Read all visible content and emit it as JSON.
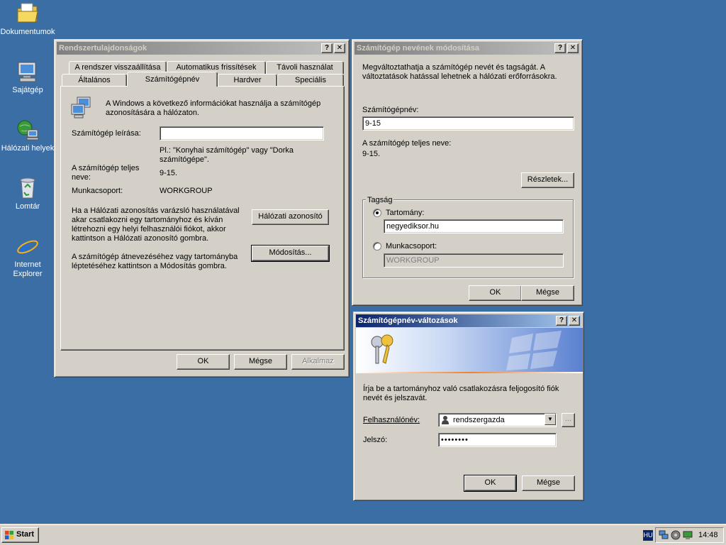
{
  "desktop": {
    "icons": [
      {
        "label": "Dokumentumok",
        "icon": "folder-documents-icon"
      },
      {
        "label": "Sajátgép",
        "icon": "my-computer-icon"
      },
      {
        "label": "Hálózati helyek",
        "icon": "network-places-icon"
      },
      {
        "label": "Lomtár",
        "icon": "recycle-bin-icon"
      },
      {
        "label": "Internet Explorer",
        "icon": "internet-explorer-icon"
      }
    ]
  },
  "system_properties": {
    "title": "Rendszertulajdonságok",
    "tabs_row1": [
      "A rendszer visszaállítása",
      "Automatikus frissítések",
      "Távoli használat"
    ],
    "tabs_row2": [
      "Általános",
      "Számítógépnév",
      "Hardver",
      "Speciális"
    ],
    "selected_tab": "Számítógépnév",
    "intro": "A Windows a következő információkat használja a számítógép azonosítására a hálózaton.",
    "description_label": "Számítógép leírása:",
    "description_value": "",
    "example": "Pl.: \"Konyhai számítógép\" vagy \"Dorka számítógépe\".",
    "full_name_label": "A számítógép teljes neve:",
    "full_name_value": "9-15.",
    "workgroup_label": "Munkacsoport:",
    "workgroup_value": "WORKGROUP",
    "network_id_text": "Ha a Hálózati azonosítás varázsló használatával akar csatlakozni egy tartományhoz és kíván létrehozni egy helyi felhasználói fiókot, akkor kattintson a Hálózati azonosító gombra.",
    "network_id_button": "Hálózati azonosító",
    "rename_text": "A számítógép átnevezéséhez vagy tartományba léptetéséhez kattintson a Módosítás gombra.",
    "change_button": "Módosítás...",
    "ok": "OK",
    "cancel": "Mégse",
    "apply": "Alkalmaz"
  },
  "computer_name_changes": {
    "title": "Számítógép nevének módosítása",
    "intro": "Megváltoztathatja a számítógép nevét és tagságát. A változtatások hatással lehetnek a hálózati erőforrásokra.",
    "computer_name_label": "Számítógépnév:",
    "computer_name_value": "9-15",
    "full_name_label": "A számítógép teljes neve:",
    "full_name_value": "9-15.",
    "details_button": "Részletek...",
    "membership_label": "Tagság",
    "domain_label": "Tartomány:",
    "domain_value": "negyediksor.hu",
    "domain_selected": true,
    "workgroup_label": "Munkacsoport:",
    "workgroup_value": "WORKGROUP",
    "ok": "OK",
    "cancel": "Mégse"
  },
  "credentials_dialog": {
    "title": "Számítógépnév-változások",
    "prompt": "Írja be a tartományhoz való csatlakozásra feljogosító fiók nevét és jelszavát.",
    "username_label": "Felhasználónév:",
    "username_value": "rendszergazda",
    "password_label": "Jelszó:",
    "password_value": "••••••••",
    "browse_button": "...",
    "ok": "OK",
    "cancel": "Mégse"
  },
  "taskbar": {
    "start_label": "Start",
    "language": "HU",
    "clock": "14:48"
  },
  "colors": {
    "desktop": "#3a6ea5",
    "active_title_start": "#0a246a",
    "active_title_end": "#a6caf0",
    "inactive_title_start": "#808080",
    "inactive_title_end": "#c0c0c0",
    "window_face": "#d4d0c8"
  }
}
